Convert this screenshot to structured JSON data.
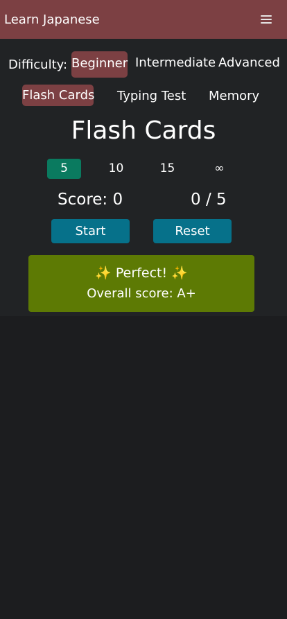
{
  "header": {
    "title": "Learn Japanese",
    "menu_icon": "hamburger-menu-icon"
  },
  "difficulty": {
    "label": "Difficulty:",
    "options": [
      "Beginner",
      "Intermediate",
      "Advanced"
    ],
    "selected": "Beginner"
  },
  "modes": {
    "options": [
      "Flash Cards",
      "Typing Test",
      "Memory"
    ],
    "selected": "Flash Cards"
  },
  "page_title": "Flash Cards",
  "card_counts": {
    "options": [
      "5",
      "10",
      "15",
      "∞"
    ],
    "selected": "5"
  },
  "score": {
    "label": "Score: 0",
    "progress": "0 / 5"
  },
  "buttons": {
    "start": "Start",
    "reset": "Reset"
  },
  "result": {
    "sparkle": "✨",
    "message": "Perfect!",
    "overall": "Overall score: A+"
  },
  "colors": {
    "header_bg": "#7c4043",
    "active_pill": "#7c4043",
    "count_active": "#0a7a5f",
    "button_bg": "#06718a",
    "result_bg": "#5d7a04",
    "page_bg": "#1c1d1f"
  }
}
